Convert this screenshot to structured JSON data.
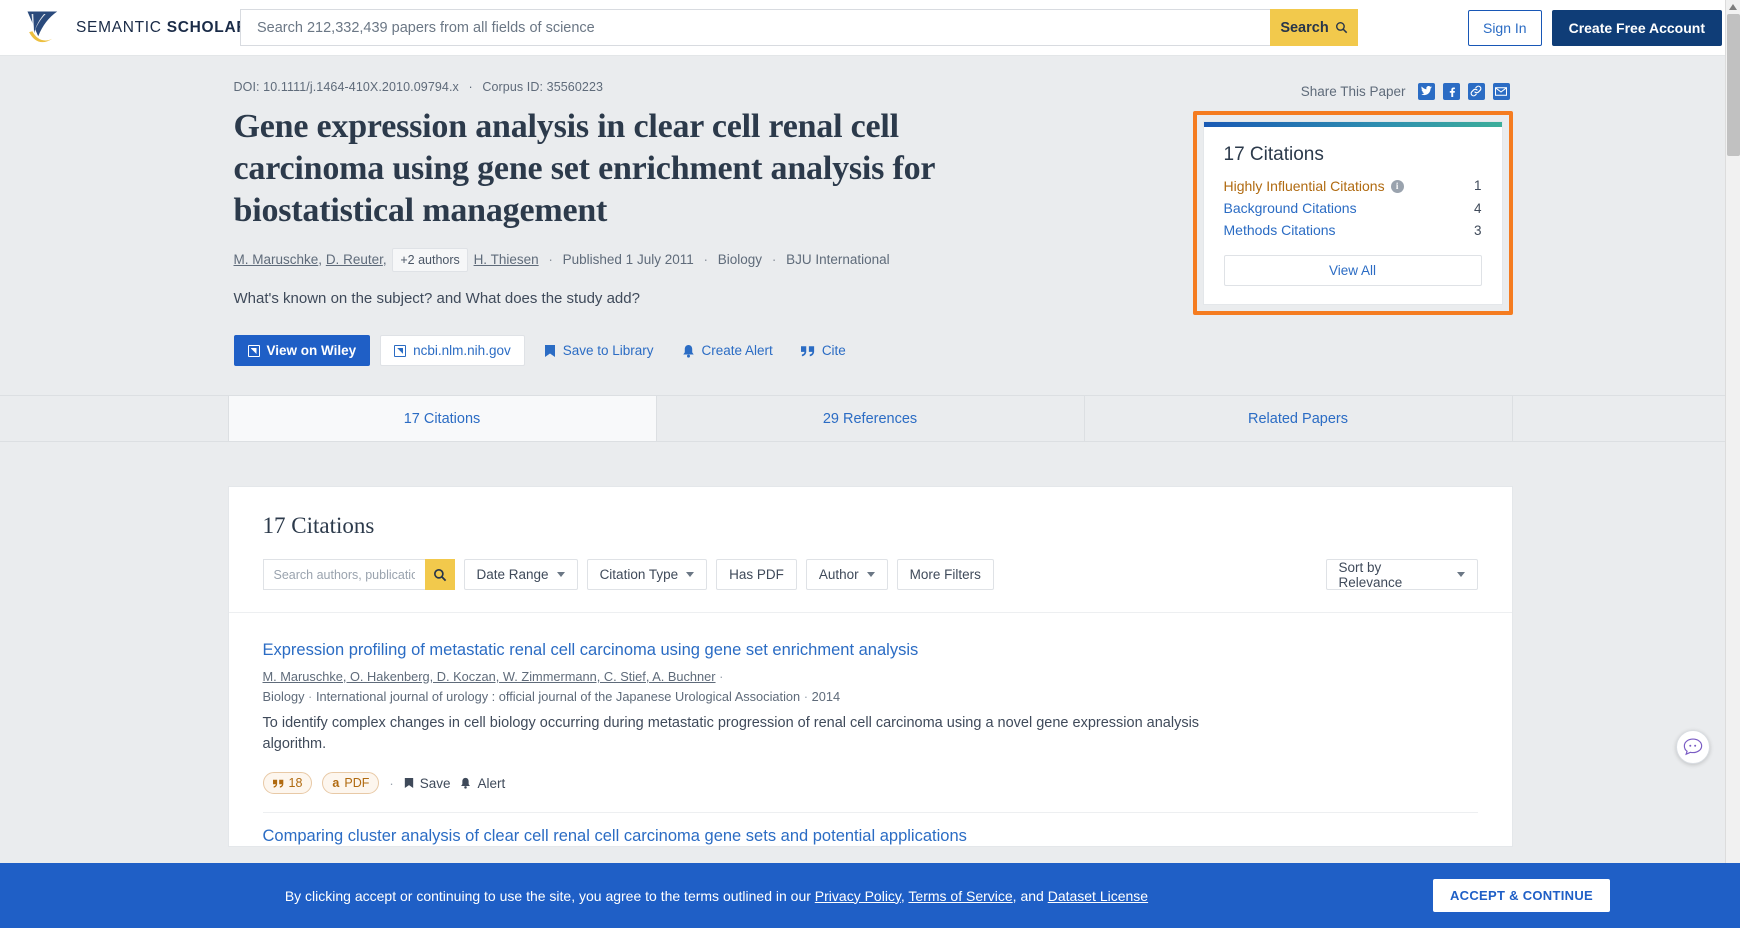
{
  "header": {
    "brand_first": "SEMANTIC",
    "brand_second": "SCHOLAR",
    "search_placeholder": "Search 212,332,439 papers from all fields of science",
    "search_value": "",
    "search_button": "Search",
    "sign_in": "Sign In",
    "create_account": "Create Free Account"
  },
  "paper": {
    "doi_label": "DOI: 10.1111/j.1464-410X.2010.09794.x",
    "corpus_label": "Corpus ID: 35560223",
    "title": "Gene expression analysis in clear cell renal cell carcinoma using gene set enrichment analysis for biostatistical management",
    "authors": [
      {
        "name": "M. Maruschke",
        "sep": ","
      },
      {
        "name": "D. Reuter",
        "sep": ","
      }
    ],
    "more_authors": "+2 authors",
    "last_author": "H. Thiesen",
    "published": "Published 1 July 2011",
    "field": "Biology",
    "venue": "BJU International",
    "tldr": "What's known on the subject? and What does the study add?",
    "actions": {
      "view_on": "View on Wiley",
      "external_site": "ncbi.nlm.nih.gov",
      "save_library": "Save to Library",
      "create_alert": "Create Alert",
      "cite": "Cite"
    }
  },
  "share": {
    "label": "Share This Paper",
    "icons": [
      "twitter-icon",
      "facebook-icon",
      "link-icon",
      "email-icon"
    ]
  },
  "citations_card": {
    "heading": "17 Citations",
    "rows": [
      {
        "label": "Highly Influential Citations",
        "count": "1",
        "has_info": true
      },
      {
        "label": "Background Citations",
        "count": "4",
        "has_info": false
      },
      {
        "label": "Methods Citations",
        "count": "3",
        "has_info": false
      }
    ],
    "view_all": "View All",
    "highlight_color": "#f57c20"
  },
  "tabs": [
    {
      "label": "17 Citations",
      "active": true
    },
    {
      "label": "29 References",
      "active": false
    },
    {
      "label": "Related Papers",
      "active": false
    }
  ],
  "results": {
    "heading": "17 Citations",
    "search_placeholder": "Search authors, publications",
    "search_value": "",
    "filters": [
      {
        "label": "Date Range",
        "caret": true
      },
      {
        "label": "Citation Type",
        "caret": true
      },
      {
        "label": "Has PDF",
        "caret": false
      },
      {
        "label": "Author",
        "caret": true
      },
      {
        "label": "More Filters",
        "caret": false
      }
    ],
    "sort": "Sort by Relevance",
    "items": [
      {
        "title": "Expression profiling of metastatic renal cell carcinoma using gene set enrichment analysis",
        "authors": "M. Maruschke, O. Hakenberg, D. Koczan, W. Zimmermann, C. Stief, A. Buchner",
        "field": "Biology",
        "venue": "International journal of urology : official journal of the Japanese Urological Association",
        "year": "2014",
        "abstract": "To identify complex changes in cell biology occurring during metastatic progression of renal cell carcinoma using a novel gene expression analysis algorithm.",
        "citation_count": "18",
        "pdf_label": "PDF",
        "save_label": "Save",
        "alert_label": "Alert"
      }
    ],
    "next_item_title": "Comparing cluster analysis of clear cell renal cell carcinoma gene sets and potential applications"
  },
  "cookie_banner": {
    "text_before": "By clicking accept or continuing to use the site, you agree to the terms outlined in our ",
    "privacy": "Privacy Policy",
    "terms": "Terms of Service",
    "and": ", and ",
    "dataset": "Dataset License",
    "accept": "ACCEPT & CONTINUE"
  }
}
